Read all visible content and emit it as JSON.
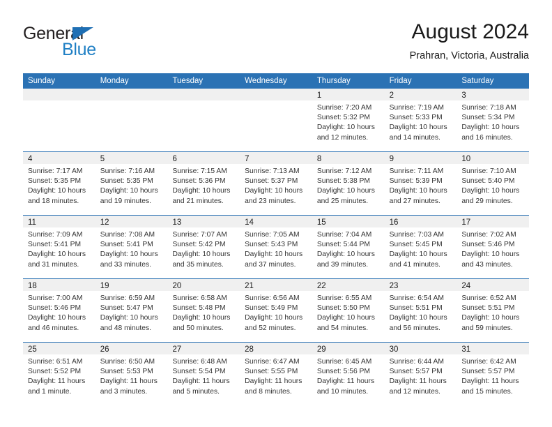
{
  "brand": {
    "name_part1": "General",
    "name_part2": "Blue",
    "triangle_color": "#1f6fb4",
    "blue_color": "#1f7fc4"
  },
  "header": {
    "title": "August 2024",
    "subtitle": "Prahran, Victoria, Australia"
  },
  "theme": {
    "header_blue": "#2b72b4",
    "daybar_gray": "#f0f0f0",
    "text": "#1a1a1a"
  },
  "weekdays": [
    "Sunday",
    "Monday",
    "Tuesday",
    "Wednesday",
    "Thursday",
    "Friday",
    "Saturday"
  ],
  "weeks": [
    [
      {
        "day": "",
        "empty": true
      },
      {
        "day": "",
        "empty": true
      },
      {
        "day": "",
        "empty": true
      },
      {
        "day": "",
        "empty": true
      },
      {
        "day": "1",
        "sunrise": "Sunrise: 7:20 AM",
        "sunset": "Sunset: 5:32 PM",
        "daylight": "Daylight: 10 hours and 12 minutes."
      },
      {
        "day": "2",
        "sunrise": "Sunrise: 7:19 AM",
        "sunset": "Sunset: 5:33 PM",
        "daylight": "Daylight: 10 hours and 14 minutes."
      },
      {
        "day": "3",
        "sunrise": "Sunrise: 7:18 AM",
        "sunset": "Sunset: 5:34 PM",
        "daylight": "Daylight: 10 hours and 16 minutes."
      }
    ],
    [
      {
        "day": "4",
        "sunrise": "Sunrise: 7:17 AM",
        "sunset": "Sunset: 5:35 PM",
        "daylight": "Daylight: 10 hours and 18 minutes."
      },
      {
        "day": "5",
        "sunrise": "Sunrise: 7:16 AM",
        "sunset": "Sunset: 5:35 PM",
        "daylight": "Daylight: 10 hours and 19 minutes."
      },
      {
        "day": "6",
        "sunrise": "Sunrise: 7:15 AM",
        "sunset": "Sunset: 5:36 PM",
        "daylight": "Daylight: 10 hours and 21 minutes."
      },
      {
        "day": "7",
        "sunrise": "Sunrise: 7:13 AM",
        "sunset": "Sunset: 5:37 PM",
        "daylight": "Daylight: 10 hours and 23 minutes."
      },
      {
        "day": "8",
        "sunrise": "Sunrise: 7:12 AM",
        "sunset": "Sunset: 5:38 PM",
        "daylight": "Daylight: 10 hours and 25 minutes."
      },
      {
        "day": "9",
        "sunrise": "Sunrise: 7:11 AM",
        "sunset": "Sunset: 5:39 PM",
        "daylight": "Daylight: 10 hours and 27 minutes."
      },
      {
        "day": "10",
        "sunrise": "Sunrise: 7:10 AM",
        "sunset": "Sunset: 5:40 PM",
        "daylight": "Daylight: 10 hours and 29 minutes."
      }
    ],
    [
      {
        "day": "11",
        "sunrise": "Sunrise: 7:09 AM",
        "sunset": "Sunset: 5:41 PM",
        "daylight": "Daylight: 10 hours and 31 minutes."
      },
      {
        "day": "12",
        "sunrise": "Sunrise: 7:08 AM",
        "sunset": "Sunset: 5:41 PM",
        "daylight": "Daylight: 10 hours and 33 minutes."
      },
      {
        "day": "13",
        "sunrise": "Sunrise: 7:07 AM",
        "sunset": "Sunset: 5:42 PM",
        "daylight": "Daylight: 10 hours and 35 minutes."
      },
      {
        "day": "14",
        "sunrise": "Sunrise: 7:05 AM",
        "sunset": "Sunset: 5:43 PM",
        "daylight": "Daylight: 10 hours and 37 minutes."
      },
      {
        "day": "15",
        "sunrise": "Sunrise: 7:04 AM",
        "sunset": "Sunset: 5:44 PM",
        "daylight": "Daylight: 10 hours and 39 minutes."
      },
      {
        "day": "16",
        "sunrise": "Sunrise: 7:03 AM",
        "sunset": "Sunset: 5:45 PM",
        "daylight": "Daylight: 10 hours and 41 minutes."
      },
      {
        "day": "17",
        "sunrise": "Sunrise: 7:02 AM",
        "sunset": "Sunset: 5:46 PM",
        "daylight": "Daylight: 10 hours and 43 minutes."
      }
    ],
    [
      {
        "day": "18",
        "sunrise": "Sunrise: 7:00 AM",
        "sunset": "Sunset: 5:46 PM",
        "daylight": "Daylight: 10 hours and 46 minutes."
      },
      {
        "day": "19",
        "sunrise": "Sunrise: 6:59 AM",
        "sunset": "Sunset: 5:47 PM",
        "daylight": "Daylight: 10 hours and 48 minutes."
      },
      {
        "day": "20",
        "sunrise": "Sunrise: 6:58 AM",
        "sunset": "Sunset: 5:48 PM",
        "daylight": "Daylight: 10 hours and 50 minutes."
      },
      {
        "day": "21",
        "sunrise": "Sunrise: 6:56 AM",
        "sunset": "Sunset: 5:49 PM",
        "daylight": "Daylight: 10 hours and 52 minutes."
      },
      {
        "day": "22",
        "sunrise": "Sunrise: 6:55 AM",
        "sunset": "Sunset: 5:50 PM",
        "daylight": "Daylight: 10 hours and 54 minutes."
      },
      {
        "day": "23",
        "sunrise": "Sunrise: 6:54 AM",
        "sunset": "Sunset: 5:51 PM",
        "daylight": "Daylight: 10 hours and 56 minutes."
      },
      {
        "day": "24",
        "sunrise": "Sunrise: 6:52 AM",
        "sunset": "Sunset: 5:51 PM",
        "daylight": "Daylight: 10 hours and 59 minutes."
      }
    ],
    [
      {
        "day": "25",
        "sunrise": "Sunrise: 6:51 AM",
        "sunset": "Sunset: 5:52 PM",
        "daylight": "Daylight: 11 hours and 1 minute."
      },
      {
        "day": "26",
        "sunrise": "Sunrise: 6:50 AM",
        "sunset": "Sunset: 5:53 PM",
        "daylight": "Daylight: 11 hours and 3 minutes."
      },
      {
        "day": "27",
        "sunrise": "Sunrise: 6:48 AM",
        "sunset": "Sunset: 5:54 PM",
        "daylight": "Daylight: 11 hours and 5 minutes."
      },
      {
        "day": "28",
        "sunrise": "Sunrise: 6:47 AM",
        "sunset": "Sunset: 5:55 PM",
        "daylight": "Daylight: 11 hours and 8 minutes."
      },
      {
        "day": "29",
        "sunrise": "Sunrise: 6:45 AM",
        "sunset": "Sunset: 5:56 PM",
        "daylight": "Daylight: 11 hours and 10 minutes."
      },
      {
        "day": "30",
        "sunrise": "Sunrise: 6:44 AM",
        "sunset": "Sunset: 5:57 PM",
        "daylight": "Daylight: 11 hours and 12 minutes."
      },
      {
        "day": "31",
        "sunrise": "Sunrise: 6:42 AM",
        "sunset": "Sunset: 5:57 PM",
        "daylight": "Daylight: 11 hours and 15 minutes."
      }
    ]
  ]
}
